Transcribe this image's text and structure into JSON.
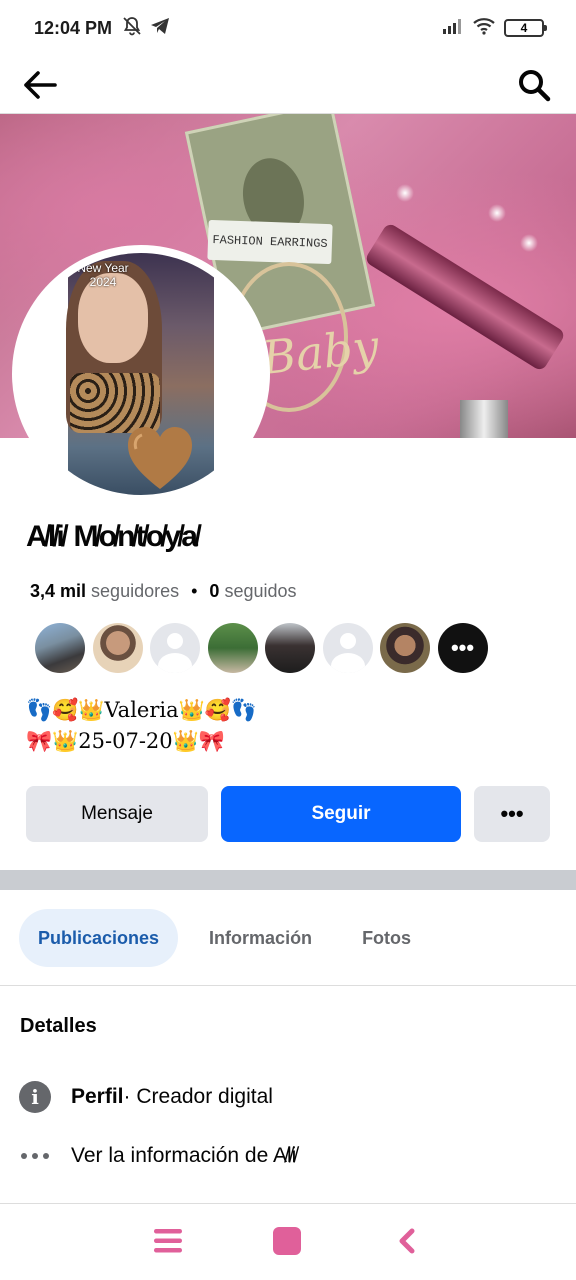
{
  "status_bar": {
    "time": "12:04 PM",
    "battery": "4"
  },
  "cover": {
    "card_text": "FASHION EARRINGS",
    "hoop_text": "Baby"
  },
  "avatar": {
    "caption": "New Year\n2024"
  },
  "profile": {
    "name": "A̸l̸i̸ M̸o̸n̸t̸o̸y̸a̸",
    "followers_count": "3,4 mil",
    "followers_label": "seguidores",
    "following_count": "0",
    "following_label": "seguidos",
    "bio_line1": "👣🥰👑Valeria👑🥰👣",
    "bio_line2": "🎀👑25-07-20👑🎀"
  },
  "actions": {
    "message": "Mensaje",
    "follow": "Seguir",
    "more": "•••"
  },
  "tabs": [
    {
      "label": "Publicaciones",
      "active": true
    },
    {
      "label": "Información",
      "active": false
    },
    {
      "label": "Fotos",
      "active": false
    }
  ],
  "details": {
    "title": "Detalles",
    "profile_label": "Perfil",
    "profile_value": " · Creador digital",
    "see_info": "Ver la información de A̸l̸i̸"
  },
  "colors": {
    "primary_blue": "#0866ff",
    "nav_pink": "#e0609a"
  }
}
